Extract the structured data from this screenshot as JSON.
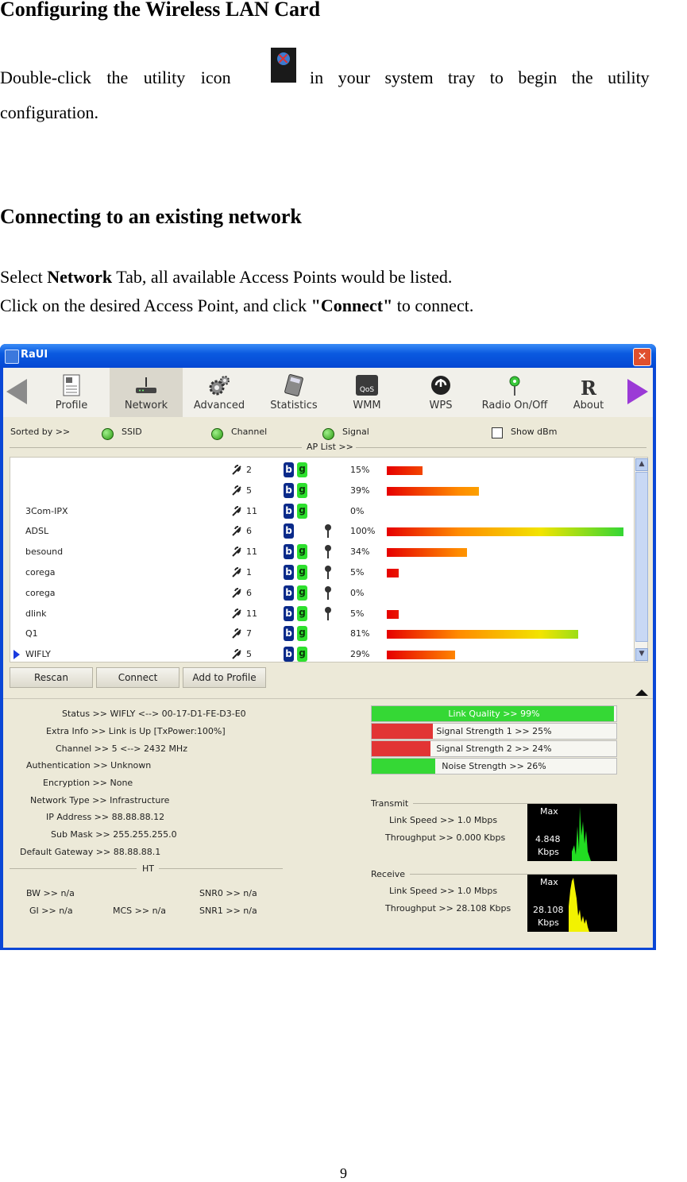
{
  "doc": {
    "title": "Configuring the Wireless LAN Card",
    "p1_pre": "Double-click the utility icon",
    "p1_post": "in your system tray to begin the utility",
    "p1_line2": "configuration.",
    "heading2": "Connecting to an existing network",
    "p2_pre": "Select ",
    "p2_bold": "Network",
    "p2_post": " Tab, all available Access Points would be listed.",
    "p3_pre": "Click on the desired Access Point, and click ",
    "p3_bold": "\"Connect\"",
    "p3_post": " to connect.",
    "page_number": "9"
  },
  "window": {
    "title": "RaUI",
    "close": "✕"
  },
  "toolbar": {
    "items": [
      {
        "label": "Profile",
        "icon": "profile-icon"
      },
      {
        "label": "Network",
        "icon": "router-icon"
      },
      {
        "label": "Advanced",
        "icon": "gears-icon"
      },
      {
        "label": "Statistics",
        "icon": "calculator-icon"
      },
      {
        "label": "WMM",
        "icon": "qos-icon"
      },
      {
        "label": "WPS",
        "icon": "wps-icon"
      },
      {
        "label": "Radio On/Off",
        "icon": "antenna-icon"
      },
      {
        "label": "About",
        "icon": "about-r-icon"
      }
    ]
  },
  "sort": {
    "label": "Sorted by >>",
    "ssid": "SSID",
    "channel": "Channel",
    "signal": "Signal",
    "show_dbm": "Show dBm"
  },
  "ap_list": {
    "label": "AP List >>",
    "rows": [
      {
        "ssid": "",
        "channel": "2",
        "g": true,
        "key": false,
        "signal": "15%",
        "level": 0.15
      },
      {
        "ssid": "",
        "channel": "5",
        "g": true,
        "key": false,
        "signal": "39%",
        "level": 0.39
      },
      {
        "ssid": "3Com-IPX",
        "channel": "11",
        "g": true,
        "key": false,
        "signal": "0%",
        "level": 0
      },
      {
        "ssid": "ADSL",
        "channel": "6",
        "g": false,
        "key": true,
        "signal": "100%",
        "level": 1.0
      },
      {
        "ssid": "besound",
        "channel": "11",
        "g": true,
        "key": true,
        "signal": "34%",
        "level": 0.34
      },
      {
        "ssid": "corega",
        "channel": "1",
        "g": true,
        "key": true,
        "signal": "5%",
        "level": 0.05
      },
      {
        "ssid": "corega",
        "channel": "6",
        "g": true,
        "key": true,
        "signal": "0%",
        "level": 0
      },
      {
        "ssid": "dlink",
        "channel": "11",
        "g": true,
        "key": true,
        "signal": "5%",
        "level": 0.05
      },
      {
        "ssid": "Q1",
        "channel": "7",
        "g": true,
        "key": false,
        "signal": "81%",
        "level": 0.81
      },
      {
        "ssid": "WIFLY",
        "channel": "5",
        "g": true,
        "key": false,
        "signal": "29%",
        "level": 0.29,
        "current": true
      }
    ],
    "b_label": "b",
    "g_label": "g"
  },
  "buttons": {
    "rescan": "Rescan",
    "connect": "Connect",
    "add_profile": "Add to Profile"
  },
  "status": {
    "status": "Status >> WIFLY <--> 00-17-D1-FE-D3-E0",
    "extra": "Extra Info >> Link is Up [TxPower:100%]",
    "channel": "Channel >> 5 <--> 2432 MHz",
    "auth": "Authentication >> Unknown",
    "enc": "Encryption >> None",
    "nettype": "Network Type >> Infrastructure",
    "ip": "IP Address >> 88.88.88.12",
    "mask": "Sub Mask >> 255.255.255.0",
    "gw": "Default Gateway >> 88.88.88.1",
    "ht": "HT",
    "bw": "BW >> n/a",
    "gi": "GI >> n/a",
    "mcs": "MCS >> n/a",
    "snr0": "SNR0 >> n/a",
    "snr1": "SNR1 >> n/a"
  },
  "quality": [
    {
      "label": "Link Quality >> 99%",
      "level": 0.99,
      "color": "#35d835"
    },
    {
      "label": "Signal Strength 1 >> 25%",
      "level": 0.25,
      "color": "#e23434"
    },
    {
      "label": "Signal Strength 2 >> 24%",
      "level": 0.24,
      "color": "#e23434"
    },
    {
      "label": "Noise Strength >> 26%",
      "level": 0.26,
      "color": "#35d835"
    }
  ],
  "transmit": {
    "label": "Transmit",
    "link_speed": "Link Speed >> 1.0 Mbps",
    "throughput": "Throughput >> 0.000 Kbps",
    "max": "Max",
    "value": "4.848",
    "unit": "Kbps",
    "color": "#22dd22"
  },
  "receive": {
    "label": "Receive",
    "link_speed": "Link Speed >> 1.0 Mbps",
    "throughput": "Throughput >> 28.108 Kbps",
    "max": "Max",
    "value": "28.108",
    "unit": "Kbps",
    "color": "#f2f200"
  }
}
